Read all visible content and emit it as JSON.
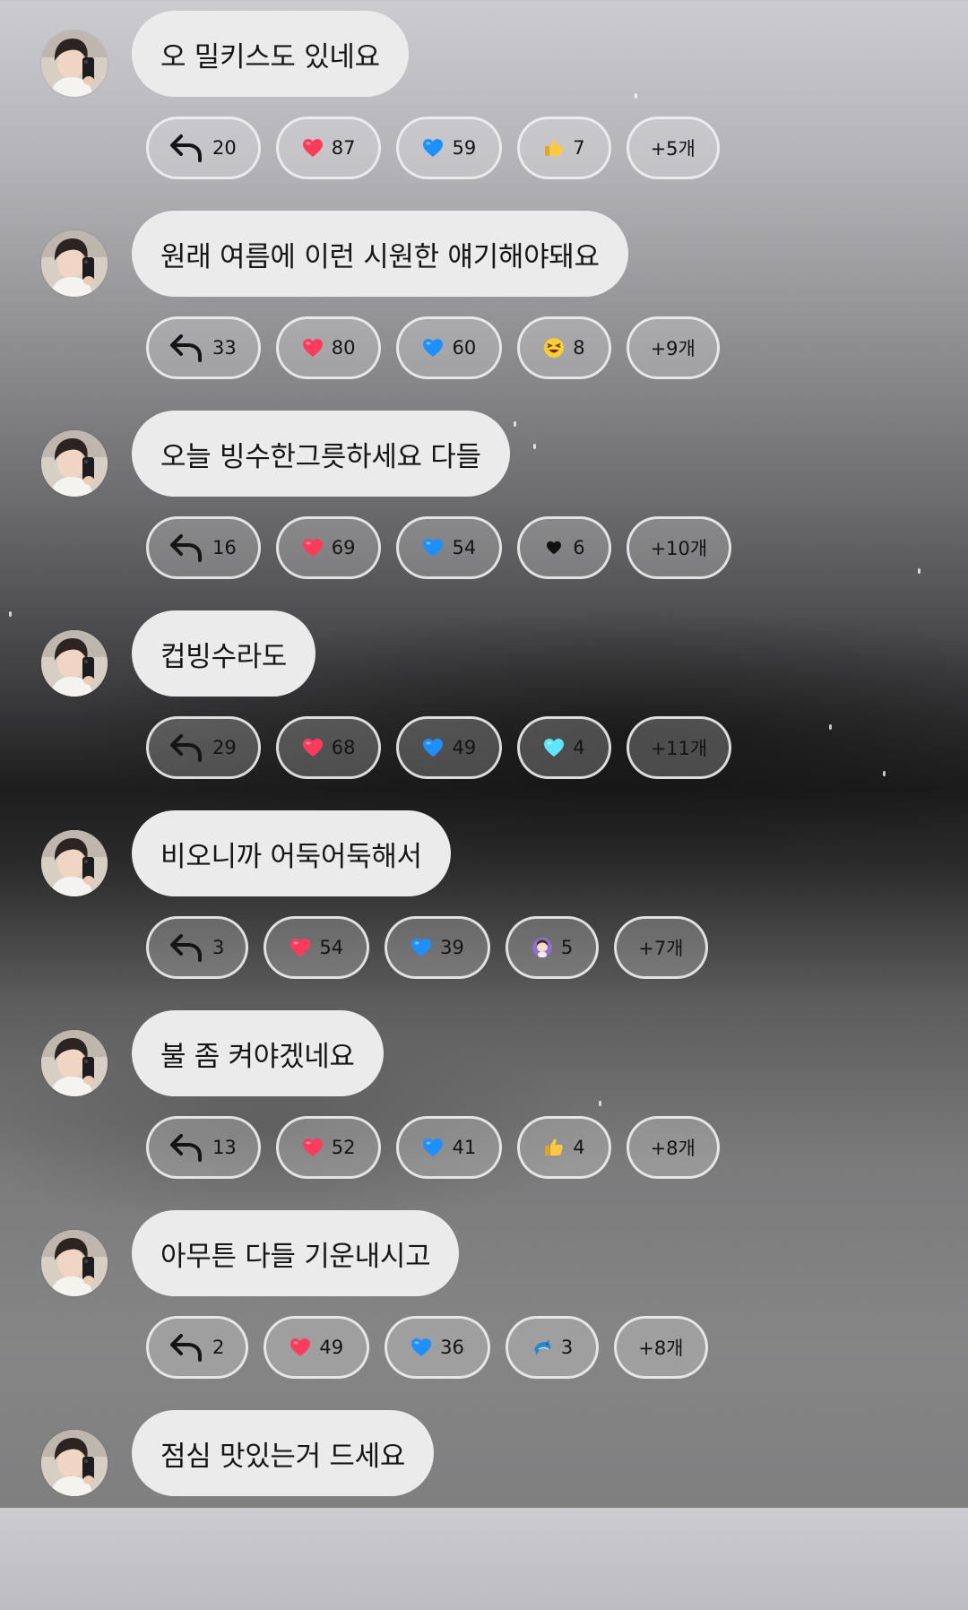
{
  "colors": {
    "bubble_bg": "#ebebec",
    "heart_red": "#ff3b5c",
    "heart_blue": "#1e8fff",
    "heart_cyan": "#5ee6ff",
    "chip_border": "#f0f0f0"
  },
  "messages": [
    {
      "text": "오 밀키스도 있네요",
      "reply_count": "20",
      "reactions": [
        {
          "icon": "red-heart-icon",
          "count": "87"
        },
        {
          "icon": "blue-heart-icon",
          "count": "59"
        },
        {
          "icon": "thumbs-up-icon",
          "count": "7"
        }
      ],
      "more": "+5개"
    },
    {
      "text": "원래 여름에 이런 시원한 얘기해야돼요",
      "reply_count": "33",
      "reactions": [
        {
          "icon": "red-heart-icon",
          "count": "80"
        },
        {
          "icon": "blue-heart-icon",
          "count": "60"
        },
        {
          "icon": "laughing-face-icon",
          "count": "8"
        }
      ],
      "more": "+9개"
    },
    {
      "text": "오늘 빙수한그릇하세요 다들",
      "reply_count": "16",
      "reactions": [
        {
          "icon": "red-heart-icon",
          "count": "69"
        },
        {
          "icon": "blue-heart-icon",
          "count": "54"
        },
        {
          "icon": "black-heart-icon",
          "count": "6"
        }
      ],
      "more": "+10개"
    },
    {
      "text": "컵빙수라도",
      "reply_count": "29",
      "reactions": [
        {
          "icon": "red-heart-icon",
          "count": "68"
        },
        {
          "icon": "blue-heart-icon",
          "count": "49"
        },
        {
          "icon": "light-blue-heart-icon",
          "count": "4"
        }
      ],
      "more": "+11개"
    },
    {
      "text": "비오니까 어둑어둑해서",
      "reply_count": "3",
      "reactions": [
        {
          "icon": "red-heart-icon",
          "count": "54"
        },
        {
          "icon": "blue-heart-icon",
          "count": "39"
        },
        {
          "icon": "person-face-icon",
          "count": "5"
        }
      ],
      "more": "+7개"
    },
    {
      "text": "불 좀 켜야겠네요",
      "reply_count": "13",
      "reactions": [
        {
          "icon": "red-heart-icon",
          "count": "52"
        },
        {
          "icon": "blue-heart-icon",
          "count": "41"
        },
        {
          "icon": "thumbs-up-icon",
          "count": "4"
        }
      ],
      "more": "+8개"
    },
    {
      "text": "아무튼 다들 기운내시고",
      "reply_count": "2",
      "reactions": [
        {
          "icon": "red-heart-icon",
          "count": "49"
        },
        {
          "icon": "blue-heart-icon",
          "count": "36"
        },
        {
          "icon": "dolphin-icon",
          "count": "3"
        }
      ],
      "more": "+8개"
    },
    {
      "text": "점심 맛있는거 드세요"
    }
  ]
}
